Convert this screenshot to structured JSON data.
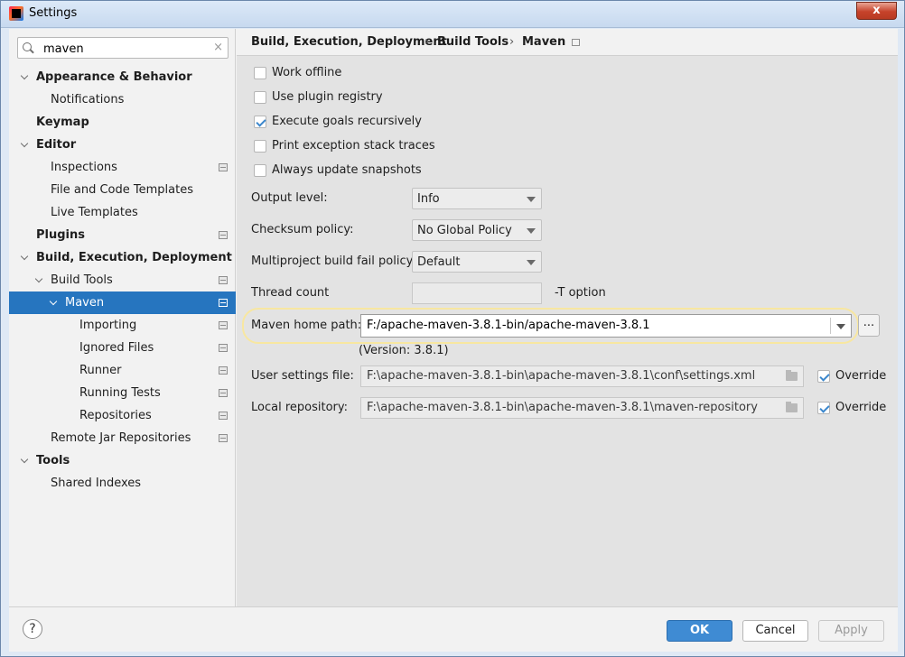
{
  "window": {
    "title": "Settings",
    "close_label": "x"
  },
  "search": {
    "value": "maven",
    "clear": "×"
  },
  "breadcrumb": [
    "Build, Execution, Deployment",
    "Build Tools",
    "Maven"
  ],
  "tree": [
    {
      "label": "Appearance & Behavior",
      "level": 0,
      "bold": true,
      "expanded": true,
      "icon": false
    },
    {
      "label": "Notifications",
      "level": 1,
      "bold": false,
      "expanded": null,
      "icon": false
    },
    {
      "label": "Keymap",
      "level": 0,
      "bold": true,
      "expanded": null,
      "icon": false
    },
    {
      "label": "Editor",
      "level": 0,
      "bold": true,
      "expanded": true,
      "icon": false
    },
    {
      "label": "Inspections",
      "level": 1,
      "bold": false,
      "expanded": null,
      "icon": true
    },
    {
      "label": "File and Code Templates",
      "level": 1,
      "bold": false,
      "expanded": null,
      "icon": false
    },
    {
      "label": "Live Templates",
      "level": 1,
      "bold": false,
      "expanded": null,
      "icon": false
    },
    {
      "label": "Plugins",
      "level": 0,
      "bold": true,
      "expanded": null,
      "icon": true
    },
    {
      "label": "Build, Execution, Deployment",
      "level": 0,
      "bold": true,
      "expanded": true,
      "icon": false
    },
    {
      "label": "Build Tools",
      "level": 1,
      "bold": false,
      "expanded": true,
      "icon": true
    },
    {
      "label": "Maven",
      "level": 2,
      "bold": false,
      "expanded": true,
      "icon": true,
      "selected": true
    },
    {
      "label": "Importing",
      "level": 3,
      "bold": false,
      "expanded": null,
      "icon": true
    },
    {
      "label": "Ignored Files",
      "level": 3,
      "bold": false,
      "expanded": null,
      "icon": true
    },
    {
      "label": "Runner",
      "level": 3,
      "bold": false,
      "expanded": null,
      "icon": true
    },
    {
      "label": "Running Tests",
      "level": 3,
      "bold": false,
      "expanded": null,
      "icon": true
    },
    {
      "label": "Repositories",
      "level": 3,
      "bold": false,
      "expanded": null,
      "icon": true
    },
    {
      "label": "Remote Jar Repositories",
      "level": 1,
      "bold": false,
      "expanded": null,
      "icon": true
    },
    {
      "label": "Tools",
      "level": 0,
      "bold": true,
      "expanded": true,
      "icon": false
    },
    {
      "label": "Shared Indexes",
      "level": 1,
      "bold": false,
      "expanded": null,
      "icon": false
    }
  ],
  "maven": {
    "checkboxes": [
      {
        "label": "Work offline",
        "checked": false
      },
      {
        "label": "Use plugin registry",
        "checked": false
      },
      {
        "label": "Execute goals recursively",
        "checked": true
      },
      {
        "label": "Print exception stack traces",
        "checked": false
      },
      {
        "label": "Always update snapshots",
        "checked": false
      }
    ],
    "output_level": {
      "label": "Output level:",
      "value": "Info"
    },
    "checksum_policy": {
      "label": "Checksum policy:",
      "value": "No Global Policy"
    },
    "fail_policy": {
      "label": "Multiproject build fail policy:",
      "value": "Default"
    },
    "thread_count": {
      "label": "Thread count",
      "value": "",
      "hint": "-T option"
    },
    "home_path": {
      "label": "Maven home path:",
      "value": "F:/apache-maven-3.8.1-bin/apache-maven-3.8.1",
      "browse": "...",
      "version": "(Version: 3.8.1)"
    },
    "user_settings": {
      "label": "User settings file:",
      "value": "F:\\apache-maven-3.8.1-bin\\apache-maven-3.8.1\\conf\\settings.xml",
      "override_label": "Override",
      "override": true
    },
    "local_repo": {
      "label": "Local repository:",
      "value": "F:\\apache-maven-3.8.1-bin\\apache-maven-3.8.1\\maven-repository",
      "override_label": "Override",
      "override": true
    }
  },
  "footer": {
    "help": "?",
    "ok": "OK",
    "cancel": "Cancel",
    "apply": "Apply"
  }
}
